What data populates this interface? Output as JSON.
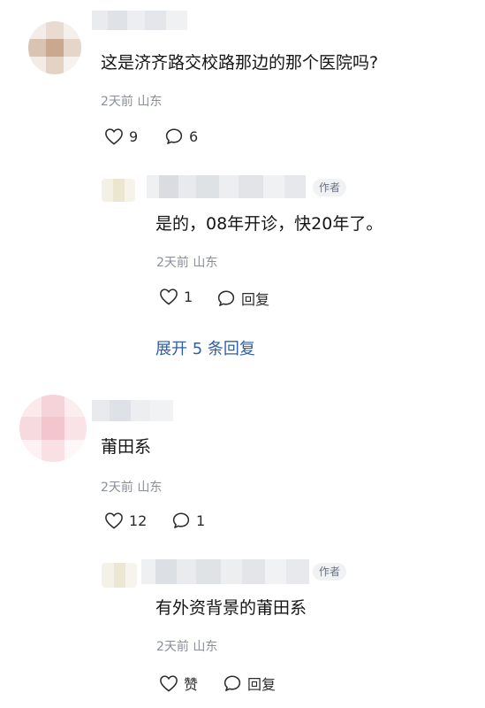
{
  "comments": [
    {
      "text": "这是济齐路交校路那边的那个医院吗?",
      "meta": "2天前 山东",
      "likes": "9",
      "replies_count": "6",
      "reply": {
        "author_tag": "作者",
        "text": "是的，08年开诊，快20年了。",
        "meta": "2天前 山东",
        "likes": "1",
        "reply_label": "回复"
      },
      "expand_label": "展开 5 条回复"
    },
    {
      "text": "莆田系",
      "meta": "2天前 山东",
      "likes": "12",
      "replies_count": "1",
      "reply": {
        "author_tag": "作者",
        "text": "有外资背景的莆田系",
        "meta": "2天前 山东",
        "like_label": "赞",
        "reply_label": "回复"
      }
    }
  ],
  "icons": {
    "like": "heart-outline-icon",
    "comment": "speech-bubble-icon"
  }
}
